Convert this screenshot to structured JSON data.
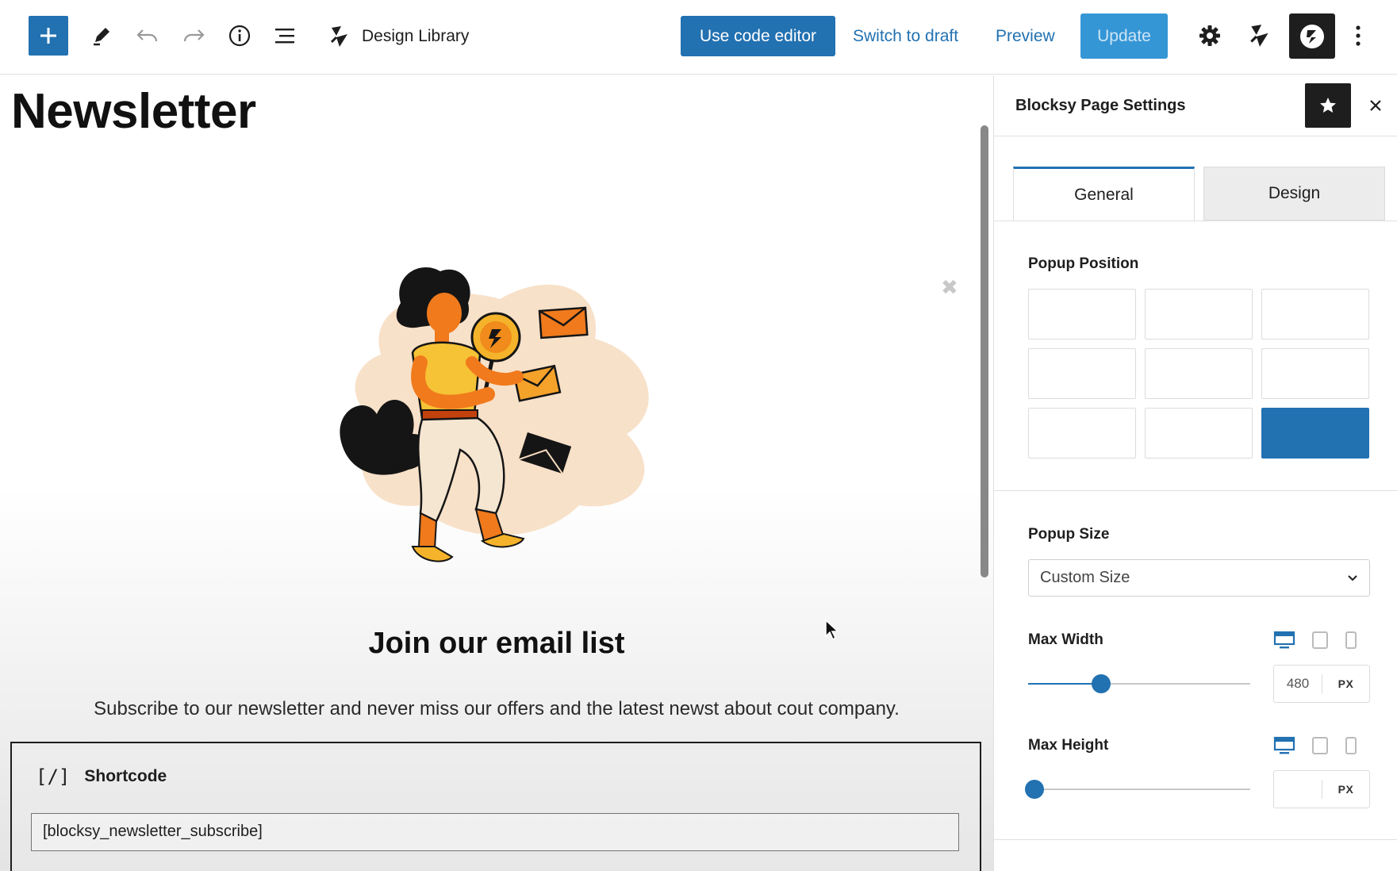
{
  "toolbar": {
    "brand_label": "Design Library",
    "code_editor_label": "Use code editor",
    "draft_label": "Switch to draft",
    "preview_label": "Preview",
    "update_label": "Update",
    "accent_color": "#2271b1",
    "icons": [
      "plus-icon",
      "pencil-icon",
      "undo-icon",
      "redo-icon",
      "info-icon",
      "list-view-icon",
      "blocksy-icon",
      "gear-icon",
      "more-vertical-icon"
    ]
  },
  "canvas": {
    "page_title": "Newsletter",
    "popup": {
      "heading": "Join our email list",
      "subtext": "Subscribe to our newsletter and never miss our offers and the latest newst about cout company.",
      "close_icon": "close-icon"
    },
    "shortcode_block": {
      "icon": "[/]",
      "label": "Shortcode",
      "value": "[blocksy_newsletter_subscribe]"
    }
  },
  "sidebar": {
    "title": "Blocksy Page Settings",
    "tabs": [
      {
        "label": "General",
        "active": true
      },
      {
        "label": "Design",
        "active": false
      }
    ],
    "popup_position": {
      "label": "Popup Position",
      "selected_index": 8
    },
    "popup_size": {
      "label": "Popup Size",
      "selected": "Custom Size"
    },
    "max_width": {
      "label": "Max Width",
      "value": "480",
      "unit": "PX",
      "slider_fraction": 0.33
    },
    "max_height": {
      "label": "Max Height",
      "value": "",
      "unit": "PX",
      "slider_fraction": 0.03
    }
  }
}
